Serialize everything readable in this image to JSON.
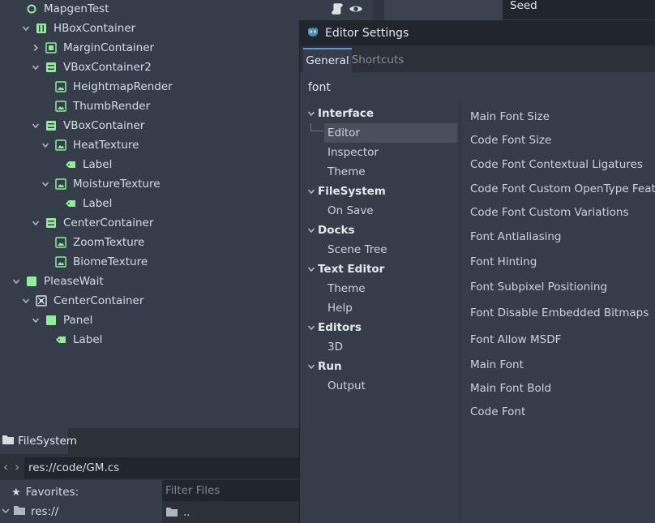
{
  "colors": {
    "accent": "#5a9bd8",
    "node_green": "#8eef97",
    "control_green": "#8eef97",
    "node_generic": "#d7dce4"
  },
  "scene_tree": {
    "rows": [
      {
        "label": "MapgenTest",
        "icon": "node-circle-icon",
        "arrow": "none",
        "indent": 0
      },
      {
        "label": "HBoxContainer",
        "icon": "hbox-container-icon",
        "arrow": "down",
        "indent": 1
      },
      {
        "label": "MarginContainer",
        "icon": "margin-container-icon",
        "arrow": "right",
        "indent": 2
      },
      {
        "label": "VBoxContainer2",
        "icon": "vbox-container-icon",
        "arrow": "down",
        "indent": 2
      },
      {
        "label": "HeightmapRender",
        "icon": "texture-rect-icon",
        "arrow": "none",
        "indent": 3
      },
      {
        "label": "ThumbRender",
        "icon": "texture-rect-icon",
        "arrow": "none",
        "indent": 3
      },
      {
        "label": "VBoxContainer",
        "icon": "vbox-container-icon",
        "arrow": "down",
        "indent": 2
      },
      {
        "label": "HeatTexture",
        "icon": "texture-rect-icon",
        "arrow": "down",
        "indent": 3
      },
      {
        "label": "Label",
        "icon": "label-icon",
        "arrow": "none",
        "indent": 4
      },
      {
        "label": "MoistureTexture",
        "icon": "texture-rect-icon",
        "arrow": "down",
        "indent": 3
      },
      {
        "label": "Label",
        "icon": "label-icon",
        "arrow": "none",
        "indent": 4
      },
      {
        "label": "CenterContainer",
        "icon": "vbox-container-icon",
        "arrow": "down",
        "indent": 2
      },
      {
        "label": "ZoomTexture",
        "icon": "texture-rect-icon",
        "arrow": "none",
        "indent": 3
      },
      {
        "label": "BiomeTexture",
        "icon": "texture-rect-icon",
        "arrow": "none",
        "indent": 3
      },
      {
        "label": "PleaseWait",
        "icon": "control-icon",
        "arrow": "down",
        "indent": 0
      },
      {
        "label": "CenterContainer",
        "icon": "center-container-icon",
        "arrow": "down",
        "indent": 1
      },
      {
        "label": "Panel",
        "icon": "panel-icon",
        "arrow": "down",
        "indent": 2
      },
      {
        "label": "Label",
        "icon": "label-icon",
        "arrow": "none",
        "indent": 3
      }
    ],
    "seed_label": "Seed"
  },
  "filesystem": {
    "tab_label": "FileSystem",
    "path": "res://code/GM.cs",
    "favorites_label": "Favorites:",
    "root_label": "res://",
    "filter_placeholder": "Filter Files",
    "parent_dir_label": ".."
  },
  "editor_settings": {
    "title": "Editor Settings",
    "tabs": [
      {
        "label": "General",
        "active": true
      },
      {
        "label": "Shortcuts",
        "active": false
      }
    ],
    "search_value": "font",
    "categories": [
      {
        "label": "Interface",
        "type": "section"
      },
      {
        "label": "Editor",
        "type": "item",
        "selected": true
      },
      {
        "label": "Inspector",
        "type": "item"
      },
      {
        "label": "Theme",
        "type": "item"
      },
      {
        "label": "FileSystem",
        "type": "section"
      },
      {
        "label": "On Save",
        "type": "item"
      },
      {
        "label": "Docks",
        "type": "section"
      },
      {
        "label": "Scene Tree",
        "type": "item"
      },
      {
        "label": "Text Editor",
        "type": "section"
      },
      {
        "label": "Theme",
        "type": "item"
      },
      {
        "label": "Help",
        "type": "item"
      },
      {
        "label": "Editors",
        "type": "section"
      },
      {
        "label": "3D",
        "type": "item"
      },
      {
        "label": "Run",
        "type": "section"
      },
      {
        "label": "Output",
        "type": "item"
      }
    ],
    "properties": [
      "Main Font Size",
      "Code Font Size",
      "Code Font Contextual Ligatures",
      "Code Font Custom OpenType Features",
      "Code Font Custom Variations",
      "Font Antialiasing",
      "Font Hinting",
      "Font Subpixel Positioning",
      "Font Disable Embedded Bitmaps",
      "Font Allow MSDF",
      "Main Font",
      "Main Font Bold",
      "Code Font"
    ]
  }
}
